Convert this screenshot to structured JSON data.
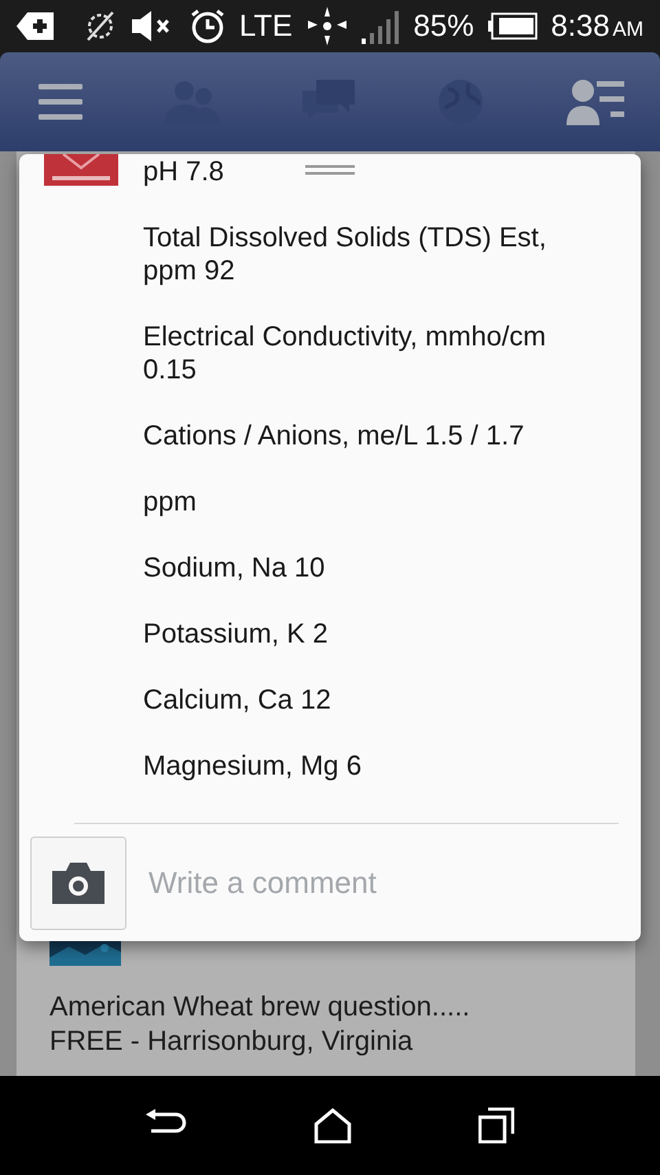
{
  "status_bar": {
    "network": "LTE",
    "battery": "85%",
    "time": "8:38",
    "meridiem": "AM"
  },
  "popup": {
    "lines": [
      "pH 7.8",
      "Total Dissolved Solids (TDS) Est, ppm 92",
      "Electrical Conductivity, mmho/cm 0.15",
      "Cations / Anions, me/L 1.5 / 1.7",
      "ppm",
      "Sodium, Na 10",
      "Potassium, K 2",
      "Calcium, Ca 12",
      "Magnesium, Mg 6"
    ],
    "comment": {
      "placeholder": "Write a comment"
    }
  },
  "feed_post": {
    "text": [
      "American Wheat brew question.....",
      "FREE - Harrisonburg, Virginia"
    ]
  }
}
